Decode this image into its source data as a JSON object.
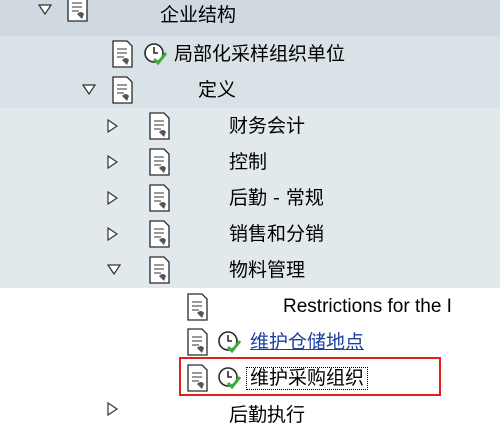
{
  "tree": {
    "nodes": [
      {
        "id": "n0",
        "label": "企业结构",
        "expand": "open",
        "clock": false,
        "selected": false
      },
      {
        "id": "n1",
        "label": "局部化采样组织单位",
        "expand": "none",
        "clock": true,
        "selected": false
      },
      {
        "id": "n2",
        "label": "定义",
        "expand": "open",
        "clock": false,
        "selected": false
      },
      {
        "id": "n3",
        "label": "财务会计",
        "expand": "closed",
        "clock": false,
        "selected": false
      },
      {
        "id": "n4",
        "label": "控制",
        "expand": "closed",
        "clock": false,
        "selected": false
      },
      {
        "id": "n5",
        "label": "后勤 - 常规",
        "expand": "closed",
        "clock": false,
        "selected": false
      },
      {
        "id": "n6",
        "label": "销售和分销",
        "expand": "closed",
        "clock": false,
        "selected": false
      },
      {
        "id": "n7",
        "label": "物料管理",
        "expand": "open",
        "clock": false,
        "selected": false
      },
      {
        "id": "n8",
        "label": "Restrictions for the I",
        "expand": "none",
        "clock": false,
        "selected": false
      },
      {
        "id": "n9",
        "label": "维护仓储地点",
        "expand": "none",
        "clock": true,
        "selected": false,
        "link": true
      },
      {
        "id": "n10",
        "label": "维护采购组织",
        "expand": "none",
        "clock": true,
        "selected": true
      },
      {
        "id": "n11",
        "label": "后勤执行",
        "expand": "closed",
        "clock": false,
        "selected": false
      }
    ]
  },
  "colors": {
    "band_dark": "#cfd9df",
    "band_light": "#dfe7eb",
    "link": "#1d3f9e",
    "highlight_box": "#e0211b",
    "clock_green": "#3fae3c"
  }
}
